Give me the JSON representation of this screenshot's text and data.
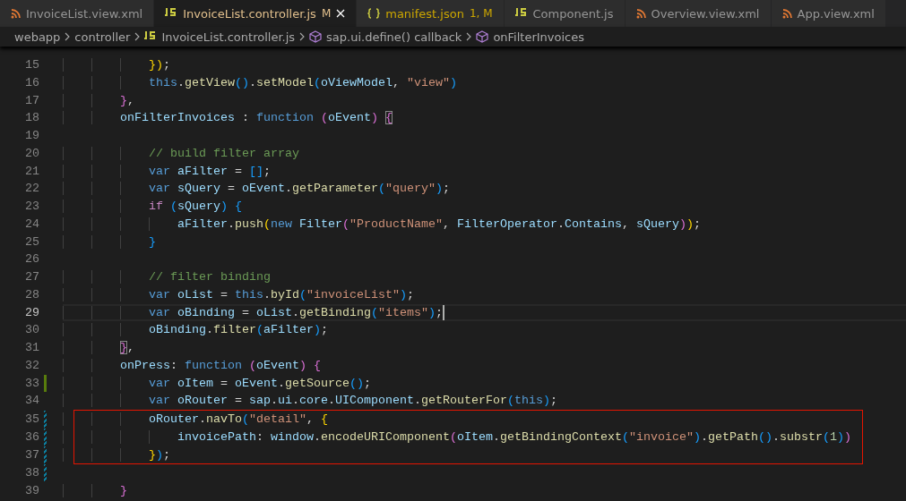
{
  "tabs": [
    {
      "label": "InvoiceList.view.xml",
      "kind": "xml",
      "selected": false,
      "modified": false,
      "warning": false
    },
    {
      "label": "InvoiceList.controller.js",
      "kind": "js",
      "selected": true,
      "modified": true,
      "warning": false,
      "badge": "M"
    },
    {
      "label": "manifest.json",
      "kind": "json",
      "selected": false,
      "modified": false,
      "warning": true,
      "badge": "1, M"
    },
    {
      "label": "Component.js",
      "kind": "js",
      "selected": false,
      "modified": false,
      "warning": false
    },
    {
      "label": "Overview.view.xml",
      "kind": "xml",
      "selected": false,
      "modified": false,
      "warning": false
    },
    {
      "label": "App.view.xml",
      "kind": "xml",
      "selected": false,
      "modified": false,
      "warning": false
    }
  ],
  "breadcrumb": [
    {
      "label": "webapp",
      "kind": "folder"
    },
    {
      "label": "controller",
      "kind": "folder"
    },
    {
      "label": "InvoiceList.controller.js",
      "kind": "js"
    },
    {
      "label": "sap.ui.define() callback",
      "kind": "symbol"
    },
    {
      "label": "onFilterInvoices",
      "kind": "symbol"
    }
  ],
  "editor": {
    "lines": [
      {
        "number": "15",
        "current": false,
        "boxed": false,
        "added": false,
        "modified": false,
        "tokens": [
          {
            "text": "            }",
            "kind": "b1"
          },
          {
            "text": ")",
            "kind": "b1"
          },
          {
            "text": ";",
            "kind": "plain"
          }
        ]
      },
      {
        "number": "16",
        "current": false,
        "boxed": false,
        "added": false,
        "modified": false,
        "tokens": [
          {
            "text": "            this",
            "kind": "kw"
          },
          {
            "text": ".",
            "kind": "plain"
          },
          {
            "text": "getView",
            "kind": "fn"
          },
          {
            "text": "()",
            "kind": "b3"
          },
          {
            "text": ".",
            "kind": "plain"
          },
          {
            "text": "setModel",
            "kind": "fn"
          },
          {
            "text": "(",
            "kind": "b3"
          },
          {
            "text": "oViewModel",
            "kind": "var"
          },
          {
            "text": ", ",
            "kind": "plain"
          },
          {
            "text": "\"view\"",
            "kind": "str"
          },
          {
            "text": ")",
            "kind": "b3"
          }
        ]
      },
      {
        "number": "17",
        "current": false,
        "boxed": false,
        "added": false,
        "modified": false,
        "tokens": [
          {
            "text": "        }",
            "kind": "b2"
          },
          {
            "text": ",",
            "kind": "plain"
          }
        ]
      },
      {
        "number": "18",
        "current": false,
        "boxed": false,
        "added": false,
        "modified": false,
        "tokens": [
          {
            "text": "        onFilterInvoices",
            "kind": "var"
          },
          {
            "text": " : ",
            "kind": "plain"
          },
          {
            "text": "function ",
            "kind": "kw"
          },
          {
            "text": "(",
            "kind": "b2"
          },
          {
            "text": "oEvent",
            "kind": "var"
          },
          {
            "text": ") ",
            "kind": "b2"
          },
          {
            "text": "{",
            "kind": "b2match"
          }
        ]
      },
      {
        "number": "19",
        "current": false,
        "boxed": false,
        "added": false,
        "modified": false
      },
      {
        "number": "20",
        "current": false,
        "boxed": false,
        "added": false,
        "modified": false,
        "tokens": [
          {
            "text": "            // build filter array",
            "kind": "comment"
          }
        ]
      },
      {
        "number": "21",
        "current": false,
        "boxed": false,
        "added": false,
        "modified": false,
        "tokens": [
          {
            "text": "            var ",
            "kind": "kw"
          },
          {
            "text": "aFilter",
            "kind": "var"
          },
          {
            "text": " = ",
            "kind": "plain"
          },
          {
            "text": "[]",
            "kind": "b3"
          },
          {
            "text": ";",
            "kind": "plain"
          }
        ]
      },
      {
        "number": "22",
        "current": false,
        "boxed": false,
        "added": false,
        "modified": false,
        "tokens": [
          {
            "text": "            var ",
            "kind": "kw"
          },
          {
            "text": "sQuery",
            "kind": "var"
          },
          {
            "text": " = ",
            "kind": "plain"
          },
          {
            "text": "oEvent",
            "kind": "var"
          },
          {
            "text": ".",
            "kind": "plain"
          },
          {
            "text": "getParameter",
            "kind": "fn"
          },
          {
            "text": "(",
            "kind": "b3"
          },
          {
            "text": "\"query\"",
            "kind": "str"
          },
          {
            "text": ")",
            "kind": "b3"
          },
          {
            "text": ";",
            "kind": "plain"
          }
        ]
      },
      {
        "number": "23",
        "current": false,
        "boxed": false,
        "added": false,
        "modified": false,
        "tokens": [
          {
            "text": "            if ",
            "kind": "ctrl"
          },
          {
            "text": "(",
            "kind": "b3"
          },
          {
            "text": "sQuery",
            "kind": "var"
          },
          {
            "text": ") ",
            "kind": "b3"
          },
          {
            "text": "{",
            "kind": "b3"
          }
        ]
      },
      {
        "number": "24",
        "current": false,
        "boxed": false,
        "added": false,
        "modified": false,
        "tokens": [
          {
            "text": "                aFilter",
            "kind": "var"
          },
          {
            "text": ".",
            "kind": "plain"
          },
          {
            "text": "push",
            "kind": "fn"
          },
          {
            "text": "(",
            "kind": "b1"
          },
          {
            "text": "new ",
            "kind": "kw"
          },
          {
            "text": "Filter",
            "kind": "var"
          },
          {
            "text": "(",
            "kind": "b2"
          },
          {
            "text": "\"ProductName\"",
            "kind": "str"
          },
          {
            "text": ", ",
            "kind": "plain"
          },
          {
            "text": "FilterOperator",
            "kind": "var"
          },
          {
            "text": ".",
            "kind": "plain"
          },
          {
            "text": "Contains",
            "kind": "var"
          },
          {
            "text": ", ",
            "kind": "plain"
          },
          {
            "text": "sQuery",
            "kind": "var"
          },
          {
            "text": ")",
            "kind": "b2"
          },
          {
            "text": ")",
            "kind": "b1"
          },
          {
            "text": ";",
            "kind": "plain"
          }
        ]
      },
      {
        "number": "25",
        "current": false,
        "boxed": false,
        "added": false,
        "modified": false,
        "tokens": [
          {
            "text": "            }",
            "kind": "b3"
          }
        ]
      },
      {
        "number": "26",
        "current": false,
        "boxed": false,
        "added": false,
        "modified": false
      },
      {
        "number": "27",
        "current": false,
        "boxed": false,
        "added": false,
        "modified": false,
        "tokens": [
          {
            "text": "            // filter binding",
            "kind": "comment"
          }
        ]
      },
      {
        "number": "28",
        "current": false,
        "boxed": false,
        "added": false,
        "modified": false,
        "tokens": [
          {
            "text": "            var ",
            "kind": "kw"
          },
          {
            "text": "oList",
            "kind": "var"
          },
          {
            "text": " = ",
            "kind": "plain"
          },
          {
            "text": "this",
            "kind": "kw"
          },
          {
            "text": ".",
            "kind": "plain"
          },
          {
            "text": "byId",
            "kind": "fn"
          },
          {
            "text": "(",
            "kind": "b3"
          },
          {
            "text": "\"invoiceList\"",
            "kind": "str"
          },
          {
            "text": ")",
            "kind": "b3"
          },
          {
            "text": ";",
            "kind": "plain"
          }
        ]
      },
      {
        "number": "29",
        "current": true,
        "boxed": false,
        "added": false,
        "modified": false,
        "tokens": [
          {
            "text": "            var ",
            "kind": "kw"
          },
          {
            "text": "oBinding",
            "kind": "var"
          },
          {
            "text": " = ",
            "kind": "plain"
          },
          {
            "text": "oList",
            "kind": "var"
          },
          {
            "text": ".",
            "kind": "plain"
          },
          {
            "text": "getBinding",
            "kind": "fn"
          },
          {
            "text": "(",
            "kind": "b3"
          },
          {
            "text": "\"items\"",
            "kind": "str"
          },
          {
            "text": ")",
            "kind": "b3"
          },
          {
            "text": ";",
            "kind": "plain"
          }
        ]
      },
      {
        "number": "30",
        "current": false,
        "boxed": false,
        "added": false,
        "modified": false,
        "tokens": [
          {
            "text": "            oBinding",
            "kind": "var"
          },
          {
            "text": ".",
            "kind": "plain"
          },
          {
            "text": "filter",
            "kind": "fn"
          },
          {
            "text": "(",
            "kind": "b3"
          },
          {
            "text": "aFilter",
            "kind": "var"
          },
          {
            "text": ")",
            "kind": "b3"
          },
          {
            "text": ";",
            "kind": "plain"
          }
        ]
      },
      {
        "number": "31",
        "current": false,
        "boxed": false,
        "added": false,
        "modified": false,
        "tokens": [
          {
            "text": "        }",
            "kind": "b2match"
          },
          {
            "text": ",",
            "kind": "plain"
          }
        ]
      },
      {
        "number": "32",
        "current": false,
        "boxed": false,
        "added": false,
        "modified": false,
        "tokens": [
          {
            "text": "        onPress",
            "kind": "var"
          },
          {
            "text": ": ",
            "kind": "plain"
          },
          {
            "text": "function ",
            "kind": "kw"
          },
          {
            "text": "(",
            "kind": "b2"
          },
          {
            "text": "oEvent",
            "kind": "var"
          },
          {
            "text": ") ",
            "kind": "b2"
          },
          {
            "text": "{",
            "kind": "b2"
          }
        ]
      },
      {
        "number": "33",
        "current": false,
        "boxed": false,
        "added": true,
        "modified": false,
        "tokens": [
          {
            "text": "            var ",
            "kind": "kw"
          },
          {
            "text": "oItem",
            "kind": "var"
          },
          {
            "text": " = ",
            "kind": "plain"
          },
          {
            "text": "oEvent",
            "kind": "var"
          },
          {
            "text": ".",
            "kind": "plain"
          },
          {
            "text": "getSource",
            "kind": "fn"
          },
          {
            "text": "()",
            "kind": "b3"
          },
          {
            "text": ";",
            "kind": "plain"
          }
        ]
      },
      {
        "number": "34",
        "current": false,
        "boxed": false,
        "added": false,
        "modified": false,
        "tokens": [
          {
            "text": "            var ",
            "kind": "kw"
          },
          {
            "text": "oRouter",
            "kind": "var"
          },
          {
            "text": " = ",
            "kind": "plain"
          },
          {
            "text": "sap",
            "kind": "var"
          },
          {
            "text": ".",
            "kind": "plain"
          },
          {
            "text": "ui",
            "kind": "var"
          },
          {
            "text": ".",
            "kind": "plain"
          },
          {
            "text": "core",
            "kind": "var"
          },
          {
            "text": ".",
            "kind": "plain"
          },
          {
            "text": "UIComponent",
            "kind": "var"
          },
          {
            "text": ".",
            "kind": "plain"
          },
          {
            "text": "getRouterFor",
            "kind": "fn"
          },
          {
            "text": "(",
            "kind": "b3"
          },
          {
            "text": "this",
            "kind": "kw"
          },
          {
            "text": ")",
            "kind": "b3"
          },
          {
            "text": ";",
            "kind": "plain"
          }
        ]
      },
      {
        "number": "35",
        "current": false,
        "boxed": true,
        "added": false,
        "modified": true,
        "tokens": [
          {
            "text": "            oRouter",
            "kind": "var"
          },
          {
            "text": ".",
            "kind": "plain"
          },
          {
            "text": "navTo",
            "kind": "fn"
          },
          {
            "text": "(",
            "kind": "b3"
          },
          {
            "text": "\"detail\"",
            "kind": "str"
          },
          {
            "text": ", ",
            "kind": "plain"
          },
          {
            "text": "{",
            "kind": "b1"
          }
        ]
      },
      {
        "number": "36",
        "current": false,
        "boxed": true,
        "added": false,
        "modified": true,
        "tokens": [
          {
            "text": "                invoicePath",
            "kind": "var"
          },
          {
            "text": ": ",
            "kind": "plain"
          },
          {
            "text": "window",
            "kind": "var"
          },
          {
            "text": ".",
            "kind": "plain"
          },
          {
            "text": "encodeURIComponent",
            "kind": "fn"
          },
          {
            "text": "(",
            "kind": "b2"
          },
          {
            "text": "oItem",
            "kind": "var"
          },
          {
            "text": ".",
            "kind": "plain"
          },
          {
            "text": "getBindingContext",
            "kind": "fn"
          },
          {
            "text": "(",
            "kind": "b3"
          },
          {
            "text": "\"invoice\"",
            "kind": "str"
          },
          {
            "text": ")",
            "kind": "b3"
          },
          {
            "text": ".",
            "kind": "plain"
          },
          {
            "text": "getPath",
            "kind": "fn"
          },
          {
            "text": "()",
            "kind": "b3"
          },
          {
            "text": ".",
            "kind": "plain"
          },
          {
            "text": "substr",
            "kind": "fn"
          },
          {
            "text": "(",
            "kind": "b3"
          },
          {
            "text": "1",
            "kind": "num"
          },
          {
            "text": ")",
            "kind": "b3"
          },
          {
            "text": ")",
            "kind": "b2"
          }
        ]
      },
      {
        "number": "37",
        "current": false,
        "boxed": true,
        "added": false,
        "modified": true,
        "tokens": [
          {
            "text": "            }",
            "kind": "b1"
          },
          {
            "text": ")",
            "kind": "b3"
          },
          {
            "text": ";",
            "kind": "plain"
          }
        ]
      },
      {
        "number": "38",
        "current": false,
        "boxed": false,
        "added": false,
        "modified": true
      },
      {
        "number": "39",
        "current": false,
        "boxed": false,
        "added": false,
        "modified": false,
        "tokens": [
          {
            "text": "        }",
            "kind": "b2"
          }
        ]
      }
    ]
  }
}
